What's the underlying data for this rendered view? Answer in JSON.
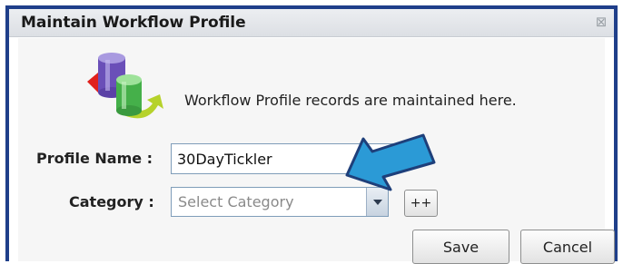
{
  "window": {
    "title": "Maintain Workflow Profile",
    "close_symbol": "⊠"
  },
  "info": {
    "text": "Workflow Profile records are maintained here.",
    "icon": "workflow-cylinders-icon"
  },
  "form": {
    "profile_name_label": "Profile Name :",
    "profile_name_value": "30DayTickler",
    "category_label": "Category :",
    "category_placeholder": "Select Category",
    "add_category_label": "++"
  },
  "buttons": {
    "save_label": "Save",
    "cancel_label": "Cancel"
  },
  "annotation": {
    "icon": "pointer-arrow-icon",
    "color": "#2b9ad6"
  },
  "colors": {
    "window_border": "#1f3f8a",
    "input_border": "#7f9db9"
  }
}
